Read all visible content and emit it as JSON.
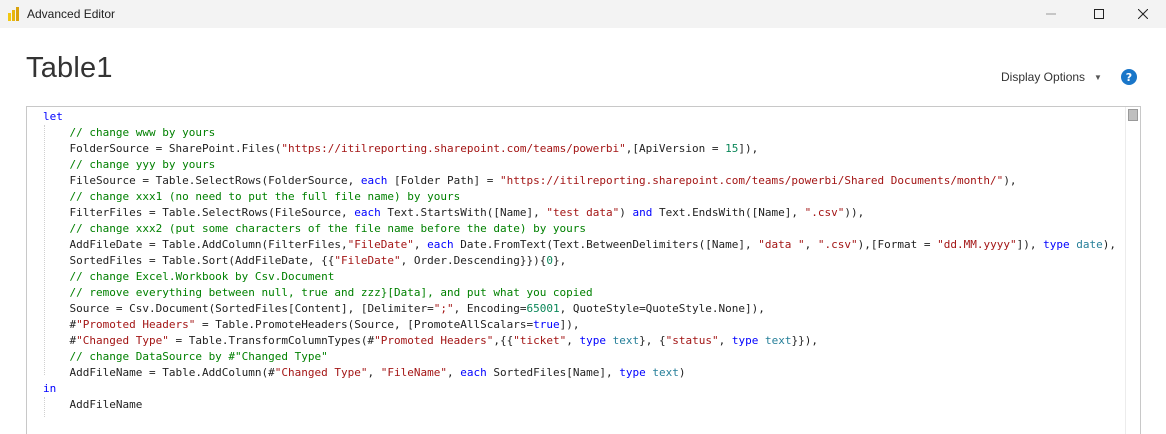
{
  "window": {
    "title": "Advanced Editor",
    "minimize_icon": "minimize-icon",
    "maximize_icon": "maximize-icon",
    "close_icon": "close-icon"
  },
  "header": {
    "query_name": "Table1",
    "display_options_label": "Display Options",
    "help_label": "?"
  },
  "editor": {
    "lines": [
      [
        {
          "t": "k",
          "v": "let"
        }
      ],
      [
        {
          "t": "c",
          "v": "    // change www by yours"
        }
      ],
      [
        {
          "t": "",
          "v": "    FolderSource = SharePoint.Files("
        },
        {
          "t": "s",
          "v": "\"https://itilreporting.sharepoint.com/teams/powerbi\""
        },
        {
          "t": "",
          "v": ",[ApiVersion = "
        },
        {
          "t": "n",
          "v": "15"
        },
        {
          "t": "",
          "v": "]),"
        }
      ],
      [
        {
          "t": "c",
          "v": "    // change yyy by yours"
        }
      ],
      [
        {
          "t": "",
          "v": "    FileSource = Table.SelectRows(FolderSource, "
        },
        {
          "t": "k",
          "v": "each"
        },
        {
          "t": "",
          "v": " [Folder Path] = "
        },
        {
          "t": "s",
          "v": "\"https://itilreporting.sharepoint.com/teams/powerbi/Shared Documents/month/\""
        },
        {
          "t": "",
          "v": "),"
        }
      ],
      [
        {
          "t": "c",
          "v": "    // change xxx1 (no need to put the full file name) by yours"
        }
      ],
      [
        {
          "t": "",
          "v": "    FilterFiles = Table.SelectRows(FileSource, "
        },
        {
          "t": "k",
          "v": "each"
        },
        {
          "t": "",
          "v": " Text.StartsWith([Name], "
        },
        {
          "t": "s",
          "v": "\"test data\""
        },
        {
          "t": "",
          "v": ") "
        },
        {
          "t": "k",
          "v": "and"
        },
        {
          "t": "",
          "v": " Text.EndsWith([Name], "
        },
        {
          "t": "s",
          "v": "\".csv\""
        },
        {
          "t": "",
          "v": ")),"
        }
      ],
      [
        {
          "t": "c",
          "v": "    // change xxx2 (put some characters of the file name before the date) by yours"
        }
      ],
      [
        {
          "t": "",
          "v": "    AddFileDate = Table.AddColumn(FilterFiles,"
        },
        {
          "t": "s",
          "v": "\"FileDate\""
        },
        {
          "t": "",
          "v": ", "
        },
        {
          "t": "k",
          "v": "each"
        },
        {
          "t": "",
          "v": " Date.FromText(Text.BetweenDelimiters([Name], "
        },
        {
          "t": "s",
          "v": "\"data \""
        },
        {
          "t": "",
          "v": ", "
        },
        {
          "t": "s",
          "v": "\".csv\""
        },
        {
          "t": "",
          "v": "),[Format = "
        },
        {
          "t": "s",
          "v": "\"dd.MM.yyyy\""
        },
        {
          "t": "",
          "v": "]), "
        },
        {
          "t": "k",
          "v": "type"
        },
        {
          "t": "",
          "v": " "
        },
        {
          "t": "t",
          "v": "date"
        },
        {
          "t": "",
          "v": "),"
        }
      ],
      [
        {
          "t": "",
          "v": "    SortedFiles = Table.Sort(AddFileDate, {{"
        },
        {
          "t": "s",
          "v": "\"FileDate\""
        },
        {
          "t": "",
          "v": ", Order.Descending}}){"
        },
        {
          "t": "n",
          "v": "0"
        },
        {
          "t": "",
          "v": "},"
        }
      ],
      [
        {
          "t": "c",
          "v": "    // change Excel.Workbook by Csv.Document"
        }
      ],
      [
        {
          "t": "c",
          "v": "    // remove everything between null, true and zzz}[Data], and put what you copied"
        }
      ],
      [
        {
          "t": "",
          "v": "    Source = Csv.Document(SortedFiles[Content], [Delimiter="
        },
        {
          "t": "s",
          "v": "\";\""
        },
        {
          "t": "",
          "v": ", Encoding="
        },
        {
          "t": "n",
          "v": "65001"
        },
        {
          "t": "",
          "v": ", QuoteStyle=QuoteStyle.None]),"
        }
      ],
      [
        {
          "t": "",
          "v": "    #"
        },
        {
          "t": "s",
          "v": "\"Promoted Headers\""
        },
        {
          "t": "",
          "v": " = Table.PromoteHeaders(Source, [PromoteAllScalars="
        },
        {
          "t": "k",
          "v": "true"
        },
        {
          "t": "",
          "v": "]),"
        }
      ],
      [
        {
          "t": "",
          "v": "    #"
        },
        {
          "t": "s",
          "v": "\"Changed Type\""
        },
        {
          "t": "",
          "v": " = Table.TransformColumnTypes(#"
        },
        {
          "t": "s",
          "v": "\"Promoted Headers\""
        },
        {
          "t": "",
          "v": ",{{"
        },
        {
          "t": "s",
          "v": "\"ticket\""
        },
        {
          "t": "",
          "v": ", "
        },
        {
          "t": "k",
          "v": "type"
        },
        {
          "t": "",
          "v": " "
        },
        {
          "t": "t",
          "v": "text"
        },
        {
          "t": "",
          "v": "}, {"
        },
        {
          "t": "s",
          "v": "\"status\""
        },
        {
          "t": "",
          "v": ", "
        },
        {
          "t": "k",
          "v": "type"
        },
        {
          "t": "",
          "v": " "
        },
        {
          "t": "t",
          "v": "text"
        },
        {
          "t": "",
          "v": "}}),"
        }
      ],
      [
        {
          "t": "c",
          "v": "    // change DataSource by #\"Changed Type\""
        }
      ],
      [
        {
          "t": "",
          "v": "    AddFileName = Table.AddColumn(#"
        },
        {
          "t": "s",
          "v": "\"Changed Type\""
        },
        {
          "t": "",
          "v": ", "
        },
        {
          "t": "s",
          "v": "\"FileName\""
        },
        {
          "t": "",
          "v": ", "
        },
        {
          "t": "k",
          "v": "each"
        },
        {
          "t": "",
          "v": " SortedFiles[Name], "
        },
        {
          "t": "k",
          "v": "type"
        },
        {
          "t": "",
          "v": " "
        },
        {
          "t": "t",
          "v": "text"
        },
        {
          "t": "",
          "v": ")"
        }
      ],
      [
        {
          "t": "k",
          "v": "in"
        }
      ],
      [
        {
          "t": "",
          "v": "    AddFileName"
        }
      ]
    ]
  },
  "colors": {
    "keyword": "#0000ff",
    "comment": "#008000",
    "string": "#a31515",
    "number": "#098658",
    "type": "#267f99",
    "help_button": "#1976c9",
    "titlebar": "#f3f3f3"
  }
}
